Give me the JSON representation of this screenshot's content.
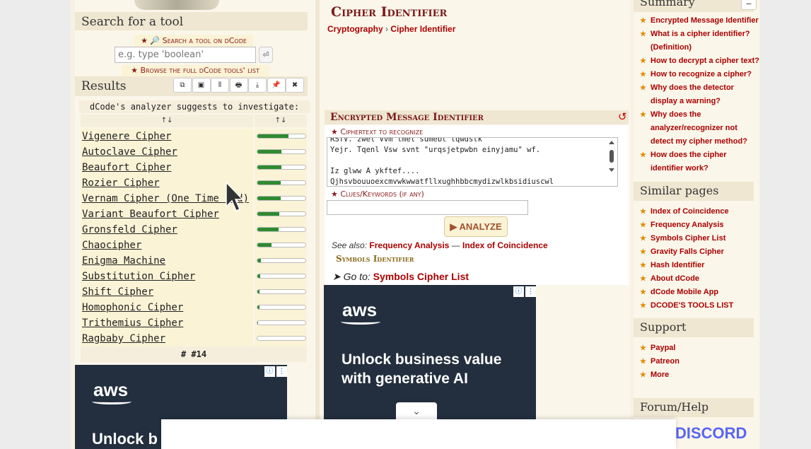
{
  "left": {
    "search_title": "Search for a tool",
    "search_link": "★ 🔎 Search a tool on dCode",
    "search_placeholder": "e.g. type 'boolean'",
    "enter_icon": "⏎",
    "browse_link": "★ Browse the full dCode tools' list",
    "results_title": "Results",
    "tool_buttons": [
      "⧉",
      "▣",
      "⫴",
      "🖶",
      "⤓",
      "📌",
      "✖"
    ],
    "analyzer_title": "dCode's analyzer suggests to investigate:",
    "col_headers": [
      "↑↓",
      "↑↓"
    ],
    "results": [
      {
        "name": "Vigenere Cipher",
        "score": 0.64
      },
      {
        "name": "Autoclave Cipher",
        "score": 0.5
      },
      {
        "name": "Beaufort Cipher",
        "score": 0.5
      },
      {
        "name": "Rozier Cipher",
        "score": 0.48
      },
      {
        "name": "Vernam Cipher (One Time Pad)",
        "score": 0.48
      },
      {
        "name": "Variant Beaufort Cipher",
        "score": 0.46
      },
      {
        "name": "Gronsfeld Cipher",
        "score": 0.44
      },
      {
        "name": "Chaocipher",
        "score": 0.3
      },
      {
        "name": "Enigma Machine",
        "score": 0.08
      },
      {
        "name": "Substitution Cipher",
        "score": 0.06
      },
      {
        "name": "Shift Cipher",
        "score": 0.05
      },
      {
        "name": "Homophonic Cipher",
        "score": 0.05
      },
      {
        "name": "Trithemius Cipher",
        "score": 0.02
      },
      {
        "name": "Ragbaby Cipher",
        "score": 0.0
      }
    ],
    "count_label": "# #14"
  },
  "mid": {
    "title": "Cipher Identifier",
    "breadcrumb": [
      "Cryptography",
      "›",
      "Cipher Identifier"
    ],
    "emi_title": "Encrypted Message Identifier",
    "reset_icon": "↺",
    "ciphertext_label": "★ Ciphertext to recognize",
    "ciphertext_lines": [
      "RSTV. zwel Vvm lmel sumebt lqwdstk",
      "Yejr. Tqenl Vsw svnt \"urqsjetpwbn einyjamu\" wf.",
      "",
      "Iz glww A ykftef....",
      "Qjhsvbouuoexcmvwkwwatfllxughhbbcmydizwlkbsidiuscwl"
    ],
    "keywords_label": "★ Clues/Keywords (if any)",
    "analyze_label": "▶ ANALYZE",
    "see_also_prefix": "See also:",
    "see_also_links": [
      "Frequency Analysis",
      "—",
      "Index of Coincidence"
    ],
    "symbols_identifier": "Symbols Identifier",
    "goto_prefix": "➤ Go to:",
    "goto_link": "Symbols Cipher List"
  },
  "right": {
    "summary_title": "Summary",
    "summary_items": [
      "Encrypted Message Identifier",
      "What is a cipher identifier? (Definition)",
      "How to decrypt a cipher text?",
      "How to recognize a cipher?",
      "Why does the detector display a warning?",
      "Why does the analyzer/recognizer not detect my cipher method?",
      "How does the cipher identifier work?"
    ],
    "similar_title": "Similar pages",
    "similar_items": [
      "Index of Coincidence",
      "Frequency Analysis",
      "Symbols Cipher List",
      "Gravity Falls Cipher",
      "Hash Identifier",
      "About dCode",
      "dCode Mobile App",
      "DCODE'S TOOLS LIST"
    ],
    "support_title": "Support",
    "support_items": [
      "Paypal",
      "Patreon",
      "More"
    ],
    "forum_title": "Forum/Help",
    "discord": "DISCORD",
    "collapse_icon": "−"
  },
  "ads": {
    "brand": "aws",
    "headline_mid": "Unlock business value with generative AI",
    "headline_left": "Unlock b",
    "ad_icons": [
      "ⓘ",
      "⋮"
    ]
  },
  "cookie": {
    "chevron": "⌄"
  }
}
